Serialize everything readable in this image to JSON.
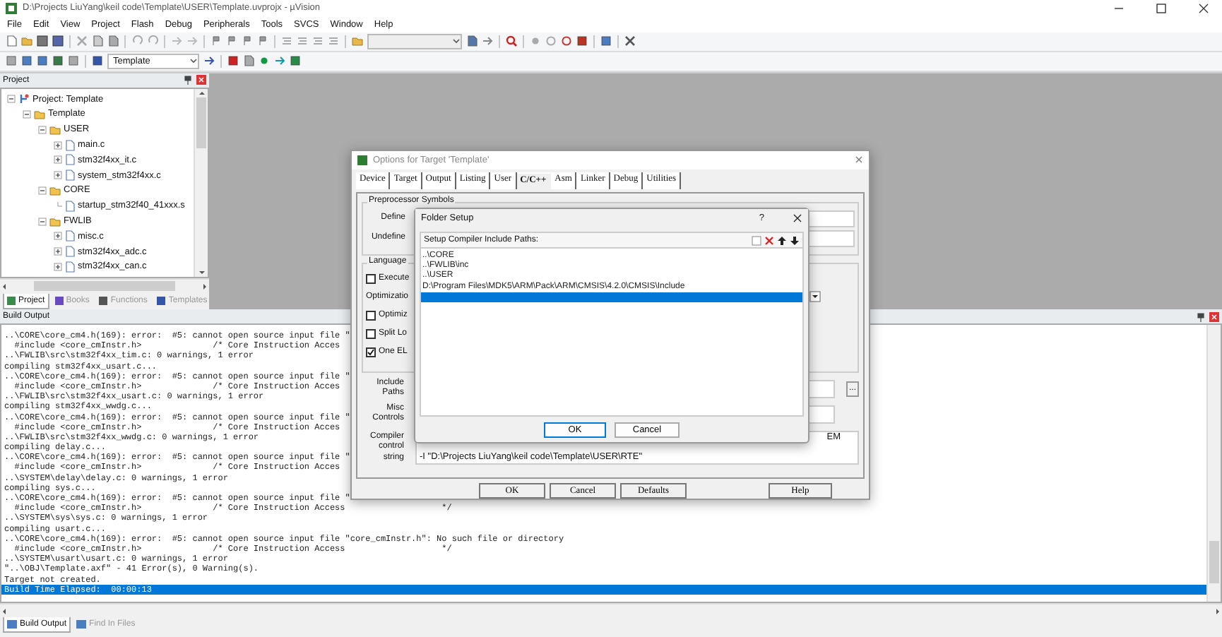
{
  "window": {
    "title": "D:\\Projects LiuYang\\keil code\\Template\\USER\\Template.uvprojx - µVision"
  },
  "menu": [
    "File",
    "Edit",
    "View",
    "Project",
    "Flash",
    "Debug",
    "Peripherals",
    "Tools",
    "SVCS",
    "Window",
    "Help"
  ],
  "toolbar": {
    "target": "Template"
  },
  "project_panel": {
    "title": "Project",
    "tree": [
      {
        "label": "Project: Template",
        "kind": "project",
        "expanded": true,
        "children": [
          {
            "label": "Template",
            "kind": "folder",
            "expanded": true,
            "children": [
              {
                "label": "USER",
                "kind": "folder",
                "expanded": true,
                "children": [
                  {
                    "label": "main.c",
                    "kind": "file",
                    "expanded": false
                  },
                  {
                    "label": "stm32f4xx_it.c",
                    "kind": "file",
                    "expanded": false
                  },
                  {
                    "label": "system_stm32f4xx.c",
                    "kind": "file",
                    "expanded": false
                  }
                ]
              },
              {
                "label": "CORE",
                "kind": "folder",
                "expanded": true,
                "children": [
                  {
                    "label": "startup_stm32f40_41xxx.s",
                    "kind": "leaf"
                  }
                ]
              },
              {
                "label": "FWLIB",
                "kind": "folder",
                "expanded": true,
                "children": [
                  {
                    "label": "misc.c",
                    "kind": "file",
                    "expanded": false
                  },
                  {
                    "label": "stm32f4xx_adc.c",
                    "kind": "file",
                    "expanded": false
                  },
                  {
                    "label": "stm32f4xx_can.c",
                    "kind": "file",
                    "expanded": false
                  }
                ]
              }
            ]
          }
        ]
      }
    ],
    "tabs": [
      {
        "label": "Project",
        "selected": true
      },
      {
        "label": "Books",
        "selected": false
      },
      {
        "label": "Functions",
        "selected": false
      },
      {
        "label": "Templates",
        "selected": false
      }
    ]
  },
  "build_output": {
    "title": "Build Output",
    "lines": [
      {
        "text": "..\\CORE\\core_cm4.h(169): error:  #5: cannot open source input file \"",
        "selected": false
      },
      {
        "text": "  #include <core_cmInstr.h>              /* Core Instruction Acces",
        "selected": false
      },
      {
        "text": "..\\FWLIB\\src\\stm32f4xx_tim.c: 0 warnings, 1 error",
        "selected": false
      },
      {
        "text": "compiling stm32f4xx_usart.c...",
        "selected": false
      },
      {
        "text": "..\\CORE\\core_cm4.h(169): error:  #5: cannot open source input file \"",
        "selected": false
      },
      {
        "text": "  #include <core_cmInstr.h>              /* Core Instruction Acces",
        "selected": false
      },
      {
        "text": "..\\FWLIB\\src\\stm32f4xx_usart.c: 0 warnings, 1 error",
        "selected": false
      },
      {
        "text": "compiling stm32f4xx_wwdg.c...",
        "selected": false
      },
      {
        "text": "..\\CORE\\core_cm4.h(169): error:  #5: cannot open source input file \"",
        "selected": false
      },
      {
        "text": "  #include <core_cmInstr.h>              /* Core Instruction Acces",
        "selected": false
      },
      {
        "text": "..\\FWLIB\\src\\stm32f4xx_wwdg.c: 0 warnings, 1 error",
        "selected": false
      },
      {
        "text": "compiling delay.c...",
        "selected": false
      },
      {
        "text": "..\\CORE\\core_cm4.h(169): error:  #5: cannot open source input file \"",
        "selected": false
      },
      {
        "text": "  #include <core_cmInstr.h>              /* Core Instruction Acces",
        "selected": false
      },
      {
        "text": "..\\SYSTEM\\delay\\delay.c: 0 warnings, 1 error",
        "selected": false
      },
      {
        "text": "compiling sys.c...",
        "selected": false
      },
      {
        "text": "..\\CORE\\core_cm4.h(169): error:  #5: cannot open source input file \"",
        "selected": false
      },
      {
        "text": "  #include <core_cmInstr.h>              /* Core Instruction Access                   */",
        "selected": false
      },
      {
        "text": "..\\SYSTEM\\sys\\sys.c: 0 warnings, 1 error",
        "selected": false
      },
      {
        "text": "compiling usart.c...",
        "selected": false
      },
      {
        "text": "..\\CORE\\core_cm4.h(169): error:  #5: cannot open source input file \"core_cmInstr.h\": No such file or directory",
        "selected": false
      },
      {
        "text": "  #include <core_cmInstr.h>              /* Core Instruction Access                   */",
        "selected": false
      },
      {
        "text": "..\\SYSTEM\\usart\\usart.c: 0 warnings, 1 error",
        "selected": false
      },
      {
        "text": "\"..\\OBJ\\Template.axf\" - 41 Error(s), 0 Warning(s).",
        "selected": false
      },
      {
        "text": "Target not created.",
        "selected": false
      },
      {
        "text": "Build Time Elapsed:  00:00:13",
        "selected": true
      }
    ],
    "tabs": [
      {
        "label": "Build Output",
        "selected": true
      },
      {
        "label": "Find In Files",
        "selected": false
      }
    ]
  },
  "options_dialog": {
    "title": "Options for Target 'Template'",
    "tabs": [
      {
        "label": "Device",
        "selected": false
      },
      {
        "label": "Target",
        "selected": false
      },
      {
        "label": "Output",
        "selected": false
      },
      {
        "label": "Listing",
        "selected": false
      },
      {
        "label": "User",
        "selected": false
      },
      {
        "label": "C/C++",
        "selected": true
      },
      {
        "label": "Asm",
        "selected": false
      },
      {
        "label": "Linker",
        "selected": false
      },
      {
        "label": "Debug",
        "selected": false
      },
      {
        "label": "Utilities",
        "selected": false
      }
    ],
    "preprocessor": {
      "title": "Preprocessor Symbols",
      "labels": [
        "Define",
        "Undefine"
      ]
    },
    "language": {
      "title": "Language",
      "optimization_label": "Optimizatio",
      "checkboxes": [
        {
          "label": "Execute",
          "checked": false
        },
        {
          "label": "Optimiz",
          "checked": false
        },
        {
          "label": "Split Lo",
          "checked": false
        },
        {
          "label": "One EL",
          "checked": true
        }
      ]
    },
    "include_paths_label": "Include Paths",
    "misc_controls_label": "Misc Controls",
    "compiler_string_label": "Compiler control string",
    "compiler_string": [
      "EM",
      "-I \"D:\\Projects LiuYang\\keil code\\Template\\USER\\RTE\""
    ],
    "browse_button": "...",
    "buttons": [
      "OK",
      "Cancel",
      "Defaults",
      "Help"
    ]
  },
  "folder_dialog": {
    "title": "Folder Setup",
    "help": "?",
    "header": "Setup Compiler Include Paths:",
    "paths": [
      {
        "text": "..\\CORE",
        "selected": false
      },
      {
        "text": "..\\FWLIB\\inc",
        "selected": false
      },
      {
        "text": "..\\USER",
        "selected": false
      },
      {
        "text": "D:\\Program Files\\MDK5\\ARM\\Pack\\ARM\\CMSIS\\4.2.0\\CMSIS\\Include",
        "selected": false
      },
      {
        "selected": true
      }
    ],
    "buttons": [
      "OK",
      "Cancel"
    ]
  }
}
